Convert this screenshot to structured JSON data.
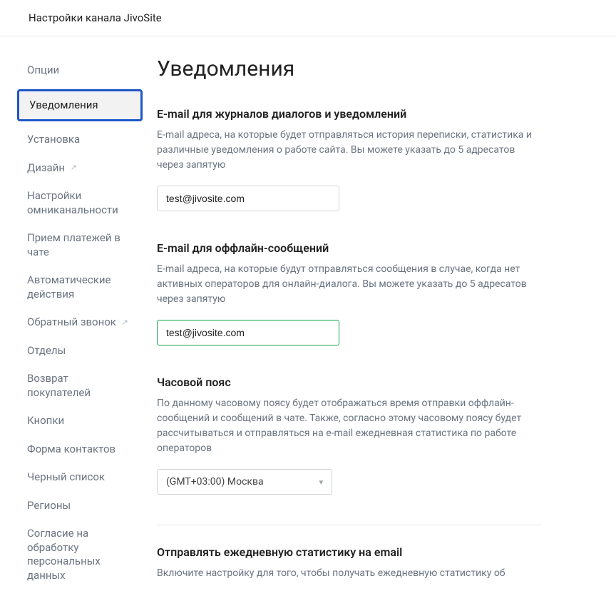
{
  "header": {
    "title": "Настройки канала JivoSite"
  },
  "sidebar": {
    "items": [
      {
        "label": "Опции",
        "external": false
      },
      {
        "label": "Уведомления",
        "external": false
      },
      {
        "label": "Установка",
        "external": false
      },
      {
        "label": "Дизайн",
        "external": true
      },
      {
        "label": "Настройки омниканальности",
        "external": false
      },
      {
        "label": "Прием платежей в чате",
        "external": false
      },
      {
        "label": "Автоматические действия",
        "external": false
      },
      {
        "label": "Обратный звонок",
        "external": true
      },
      {
        "label": "Отделы",
        "external": false
      },
      {
        "label": "Возврат покупателей",
        "external": false
      },
      {
        "label": "Кнопки",
        "external": false
      },
      {
        "label": "Форма контактов",
        "external": false
      },
      {
        "label": "Черный список",
        "external": false
      },
      {
        "label": "Регионы",
        "external": false
      },
      {
        "label": "Согласие на обработку персональных данных",
        "external": false
      }
    ]
  },
  "main": {
    "heading": "Уведомления",
    "sections": {
      "email_logs": {
        "title": "E-mail для журналов диалогов и уведомлений",
        "desc": "E-mail адреса, на которые будет отправляться история переписки, статистика и различные уведомления о работе сайта. Вы можете указать до 5 адресатов через запятую",
        "value": "test@jivosite.com"
      },
      "email_offline": {
        "title": "E-mail для оффлайн-сообщений",
        "desc": "E-mail адреса, на которые будут отправляться сообщения в случае, когда нет активных операторов для онлайн-диалога. Вы можете указать до 5 адресатов через запятую",
        "value": "test@jivosite.com"
      },
      "timezone": {
        "title": "Часовой пояс",
        "desc": "По данному часовому поясу будет отображаться время отправки оффлайн-сообщений и сообщений в чате. Также, согласно этому часовому поясу будет рассчитываться и отправляться на e-mail ежедневная статистика по работе операторов",
        "value": "(GMT+03:00) Москва"
      },
      "daily_stats": {
        "title": "Отправлять ежедневную статистику на email",
        "desc": "Включите настройку для того, чтобы получать ежедневную статистику об"
      }
    }
  }
}
